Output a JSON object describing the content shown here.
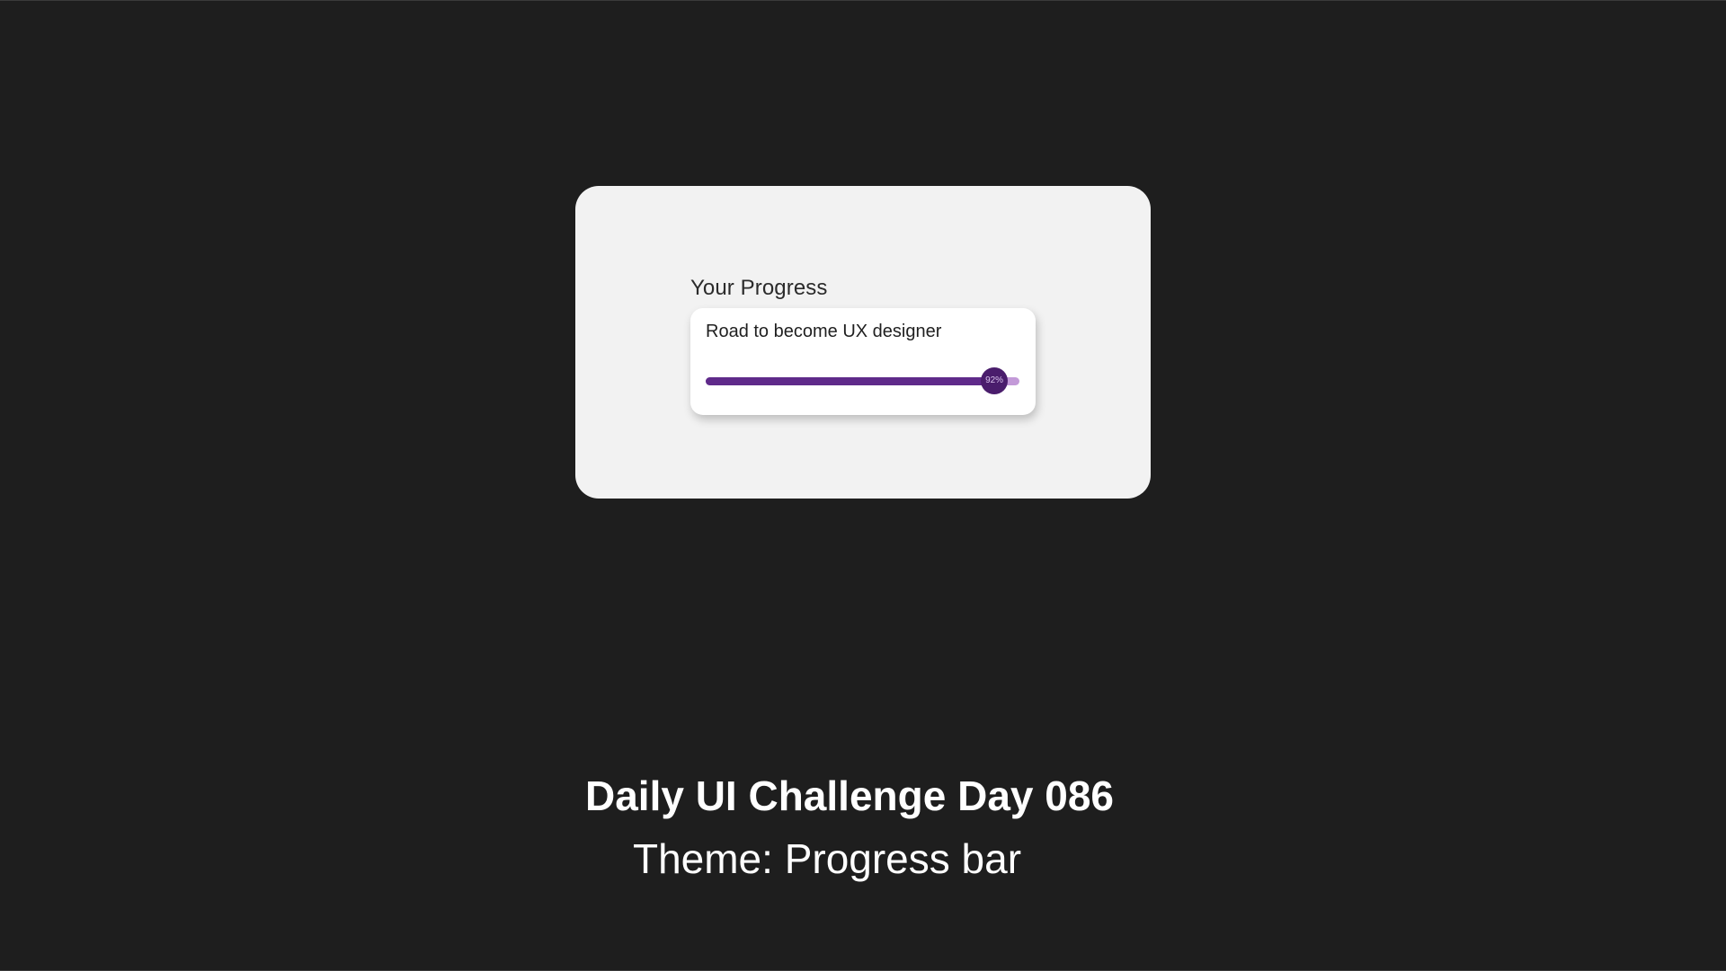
{
  "colors": {
    "background": "#1e1e1e",
    "panel": "#f2f2f2",
    "card": "#ffffff",
    "bar_fill": "#5f2a8a",
    "bar_track": "#c39ad8",
    "knob": "#4a1d6c",
    "caption_text": "#ffffff"
  },
  "progress": {
    "heading": "Your Progress",
    "card_title": "Road to become UX designer",
    "value_fraction": 0.92,
    "value_label": "92%"
  },
  "caption": {
    "title": "Daily UI Challenge Day 086",
    "theme": "Theme: Progress bar"
  }
}
